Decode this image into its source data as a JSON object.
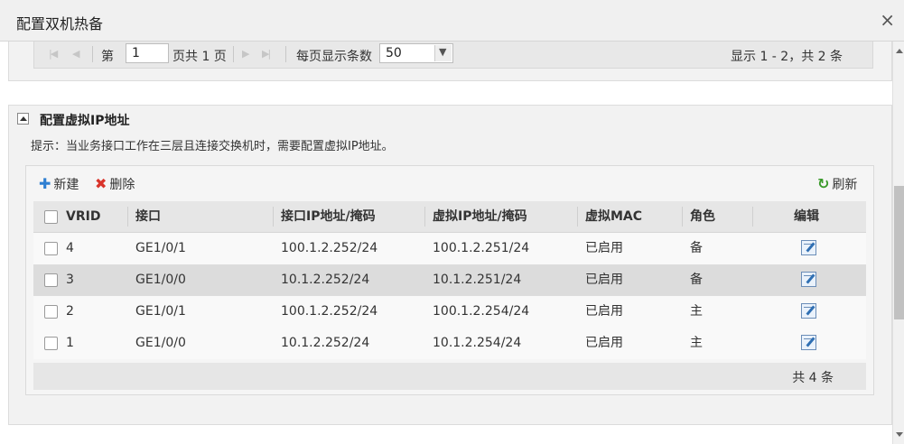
{
  "dialog": {
    "title": "配置双机热备",
    "close_symbol": "×"
  },
  "pager": {
    "page_prefix": "第",
    "page_value": "1",
    "page_suffix": "页共 1 页",
    "page_size_label": "每页显示条数",
    "page_size_value": "50",
    "display_info": "显示 1 - 2，共 2 条"
  },
  "vrrp": {
    "section_title": "配置虚拟IP地址",
    "hint": "提示：当业务接口工作在三层且连接交换机时，需要配置虚拟IP地址。",
    "toolbar": {
      "new_label": "新建",
      "delete_label": "删除",
      "refresh_label": "刷新"
    },
    "columns": [
      "VRID",
      "接口",
      "接口IP地址/掩码",
      "虚拟IP地址/掩码",
      "虚拟MAC",
      "角色",
      "编辑"
    ],
    "rows": [
      {
        "vrid": "4",
        "interface": "GE1/0/1",
        "interface_ip": "100.1.2.252/24",
        "virtual_ip": "100.1.2.251/24",
        "virtual_mac": "已启用",
        "role": "备"
      },
      {
        "vrid": "3",
        "interface": "GE1/0/0",
        "interface_ip": "10.1.2.252/24",
        "virtual_ip": "10.1.2.251/24",
        "virtual_mac": "已启用",
        "role": "备"
      },
      {
        "vrid": "2",
        "interface": "GE1/0/1",
        "interface_ip": "100.1.2.252/24",
        "virtual_ip": "100.1.2.254/24",
        "virtual_mac": "已启用",
        "role": "主"
      },
      {
        "vrid": "1",
        "interface": "GE1/0/0",
        "interface_ip": "10.1.2.252/24",
        "virtual_ip": "10.1.2.254/24",
        "virtual_mac": "已启用",
        "role": "主"
      }
    ],
    "total": "共 4 条"
  },
  "colors": {
    "new_icon": "#2f7fd1",
    "delete_icon": "#d9342b",
    "refresh_icon": "#3a9a2a"
  },
  "icons": {
    "first_page": "first-page-icon",
    "prev_page": "prev-page-icon",
    "next_page": "next-page-icon",
    "last_page": "last-page-icon",
    "edit": "edit-icon"
  }
}
